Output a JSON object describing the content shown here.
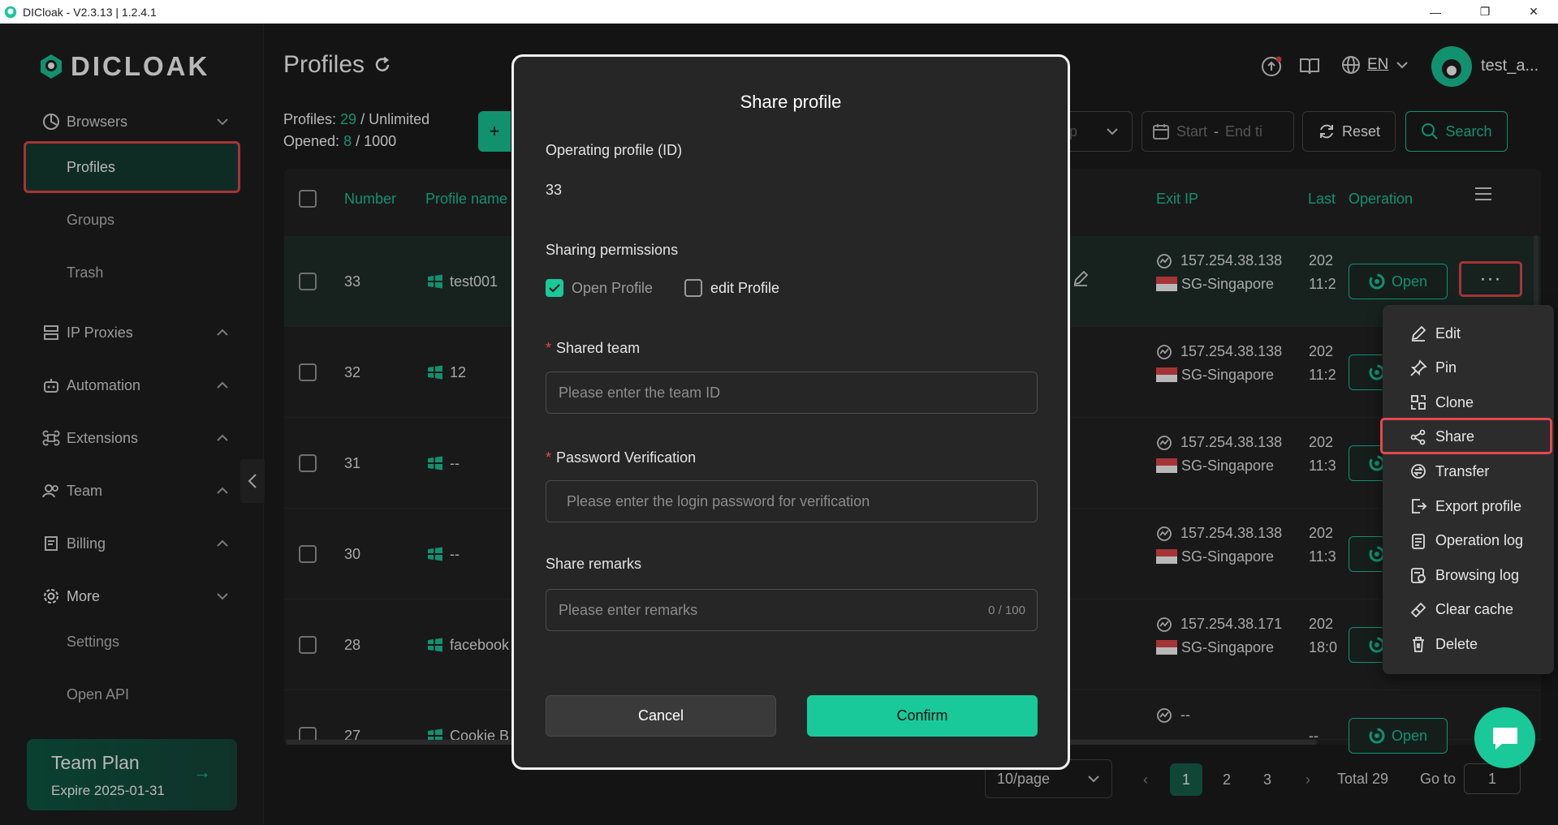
{
  "window": {
    "title": "DICloak - V2.3.13 | 1.2.4.1",
    "minimize": "—",
    "maximize": "❐",
    "close": "✕"
  },
  "sidebar": {
    "logo": "DICLOAK",
    "browsers": "Browsers",
    "profiles": "Profiles",
    "groups": "Groups",
    "trash": "Trash",
    "ip_proxies": "IP Proxies",
    "automation": "Automation",
    "extensions": "Extensions",
    "team": "Team",
    "billing": "Billing",
    "more": "More",
    "settings": "Settings",
    "open_api": "Open API",
    "plan_title": "Team Plan",
    "plan_expire": "Expire 2025-01-31",
    "plan_arrow": "→"
  },
  "header": {
    "title": "Profiles",
    "language": "EN",
    "username": "test_a..."
  },
  "stats": {
    "profiles_label": "Profiles:",
    "profiles_count": "29",
    "profiles_limit": "/ Unlimited",
    "opened_label": "Opened:",
    "opened_count": "8",
    "opened_limit": "/ 1000"
  },
  "toolbar": {
    "add_glyph": "+",
    "group_partial": "p",
    "date_start": "Start",
    "date_sep": "-",
    "date_end": "End ti",
    "reset": "Reset",
    "search": "Search"
  },
  "table": {
    "headers": {
      "number": "Number",
      "profile_name": "Profile name",
      "exit_ip": "Exit IP",
      "last": "Last",
      "operation": "Operation"
    },
    "rows": [
      {
        "number": "33",
        "name": "test001",
        "ip": "157.254.38.138",
        "region": "SG-Singapore",
        "last_a": "202",
        "last_b": "11:2"
      },
      {
        "number": "32",
        "name": "12",
        "ip": "157.254.38.138",
        "region": "SG-Singapore",
        "last_a": "202",
        "last_b": "11:2"
      },
      {
        "number": "31",
        "name": "--",
        "ip": "157.254.38.138",
        "region": "SG-Singapore",
        "last_a": "202",
        "last_b": "11:3"
      },
      {
        "number": "30",
        "name": "--",
        "ip": "157.254.38.138",
        "region": "SG-Singapore",
        "last_a": "202",
        "last_b": "11:3"
      },
      {
        "number": "28",
        "name": "facebook",
        "ip": "157.254.38.171",
        "region": "SG-Singapore",
        "last_a": "202",
        "last_b": "18:0"
      },
      {
        "number": "27",
        "name": "Cookie B",
        "ip": "--",
        "region": "--",
        "last_a": "--",
        "last_b": ""
      }
    ],
    "open_label": "Open",
    "more_label": "···"
  },
  "dropdown": {
    "items": [
      "Edit",
      "Pin",
      "Clone",
      "Share",
      "Transfer",
      "Export profile",
      "Operation log",
      "Browsing log",
      "Clear cache",
      "Delete"
    ]
  },
  "pagination": {
    "page_size": "10/page",
    "prev": "‹",
    "next": "›",
    "pages": [
      "1",
      "2",
      "3"
    ],
    "total": "Total 29",
    "goto_label": "Go to",
    "goto_value": "1"
  },
  "modal": {
    "title": "Share profile",
    "operating_label": "Operating profile (ID)",
    "operating_value": "33",
    "permissions_label": "Sharing permissions",
    "perm_open": "Open Profile",
    "perm_edit": "edit Profile",
    "required_mark": "*",
    "team_label": "Shared team",
    "team_placeholder": "Please enter the team ID",
    "password_label": "Password Verification",
    "password_placeholder": "Please enter the login password for verification",
    "remarks_label": "Share remarks",
    "remarks_placeholder": "Please enter remarks",
    "remarks_counter": "0 / 100",
    "cancel": "Cancel",
    "confirm": "Confirm"
  },
  "colors": {
    "accent": "#19c99a",
    "highlight_red": "#e5484d",
    "bg": "#1c1c1c"
  }
}
